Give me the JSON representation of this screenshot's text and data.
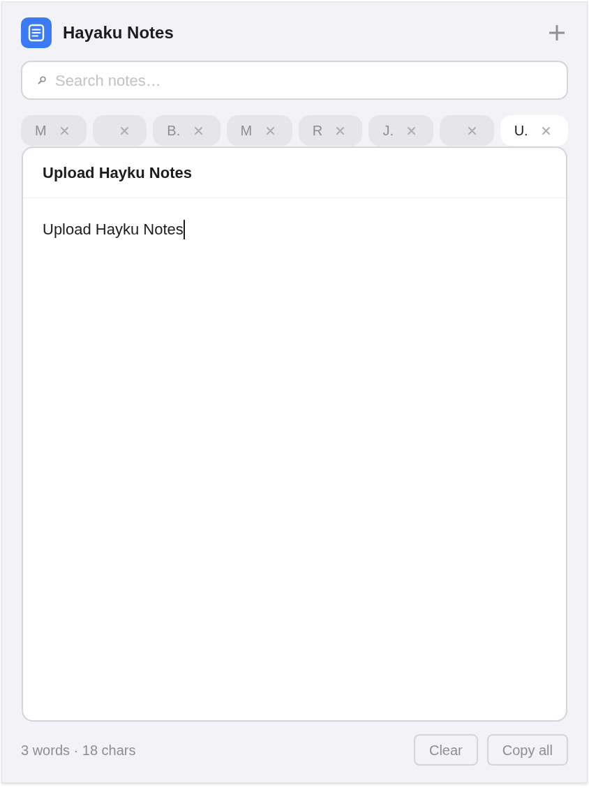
{
  "app": {
    "title": "Hayaku Notes"
  },
  "search": {
    "placeholder": "Search notes…"
  },
  "tabs": [
    {
      "label": "M",
      "selected": false
    },
    {
      "selected": false
    },
    {
      "label": "B.",
      "selected": false
    },
    {
      "label": "M",
      "selected": false
    },
    {
      "label": "R",
      "selected": false
    },
    {
      "label": "J.",
      "selected": false
    },
    {
      "selected": false
    },
    {
      "label": "U.",
      "selected": true
    }
  ],
  "note": {
    "title": "Upload Hayku Notes",
    "body": "Upload Hayku Notes",
    "focused": true
  },
  "status": "3 words · 18 chars",
  "buttons": [
    "Clear",
    "Copy all"
  ]
}
